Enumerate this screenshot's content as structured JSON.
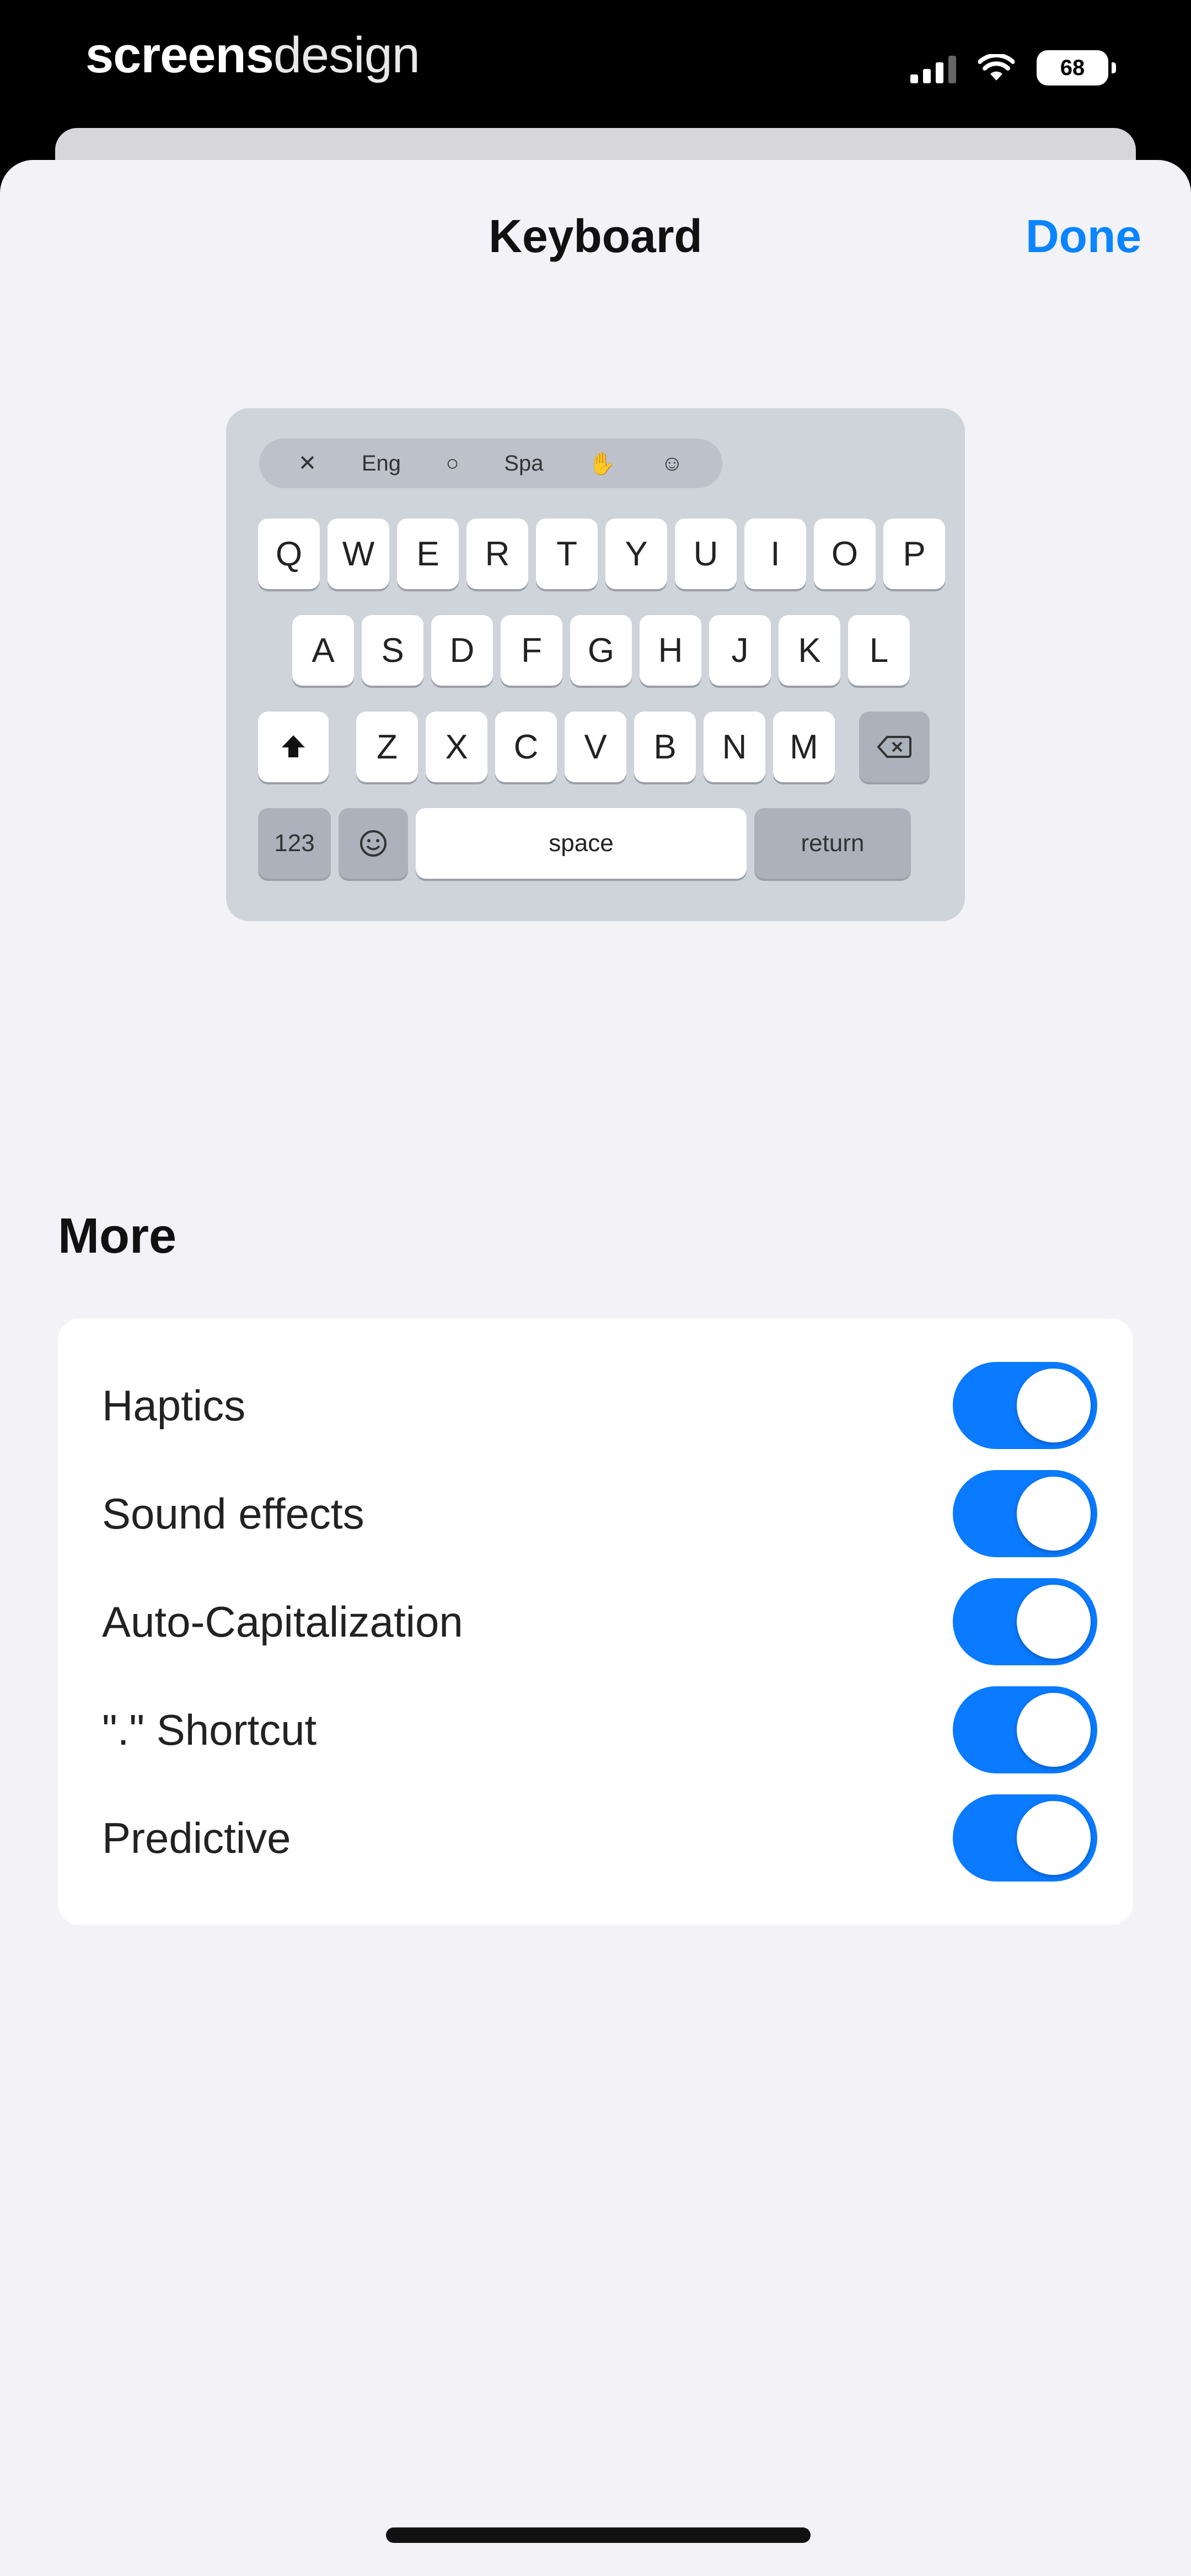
{
  "status_bar": {
    "brand_bold": "screens",
    "brand_light": "design",
    "battery": "68"
  },
  "header": {
    "title": "Keyboard",
    "done_label": "Done"
  },
  "keyboard_preview": {
    "toolbar": [
      "✕",
      "Eng",
      "○",
      "Spa",
      "✋",
      "☺"
    ],
    "row1": [
      "Q",
      "W",
      "E",
      "R",
      "T",
      "Y",
      "U",
      "I",
      "O",
      "P"
    ],
    "row2": [
      "A",
      "S",
      "D",
      "F",
      "G",
      "H",
      "J",
      "K",
      "L"
    ],
    "row3": [
      "Z",
      "X",
      "C",
      "V",
      "B",
      "N",
      "M"
    ],
    "numbers_label": "123",
    "space_label": "space",
    "return_label": "return"
  },
  "more": {
    "title": "More",
    "items": [
      {
        "label": "Haptics",
        "enabled": true
      },
      {
        "label": "Sound effects",
        "enabled": true
      },
      {
        "label": "Auto-Capitalization",
        "enabled": true
      },
      {
        "label": "\".\" Shortcut",
        "enabled": true
      },
      {
        "label": "Predictive",
        "enabled": true
      }
    ]
  },
  "colors": {
    "accent": "#0a84ff",
    "toggle_on": "#0a7aff",
    "background": "#f2f2f7"
  }
}
